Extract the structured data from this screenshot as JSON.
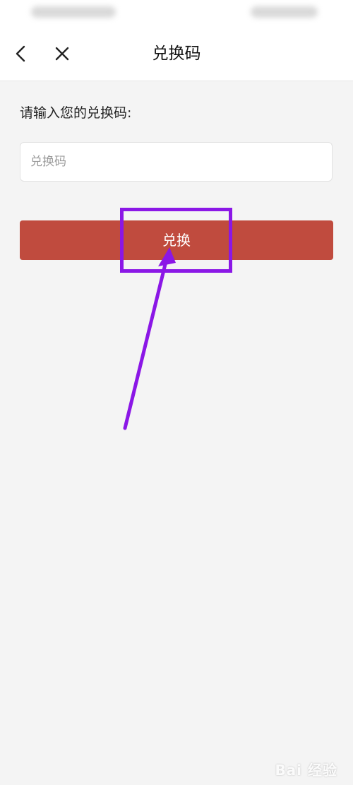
{
  "nav": {
    "title": "兑换码"
  },
  "form": {
    "prompt": "请输入您的兑换码:",
    "code_placeholder": "兑换码",
    "code_value": "",
    "submit_label": "兑换"
  },
  "colors": {
    "accent": "#c04b3e",
    "annotation": "#8b17e6",
    "background": "#f4f4f4"
  },
  "watermark": {
    "text": "Bai 经验"
  }
}
